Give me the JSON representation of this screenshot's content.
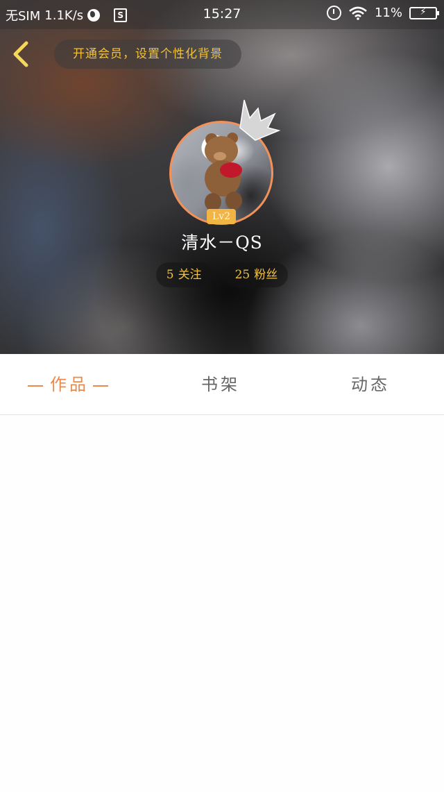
{
  "status_bar": {
    "carrier": "无SIM",
    "net_speed": "1.1K/s",
    "time": "15:27",
    "battery": "11%",
    "icons": [
      "globe-icon",
      "s-app-icon",
      "alarm-icon",
      "wifi-icon",
      "battery-charging-icon"
    ]
  },
  "header": {
    "back_icon": "chevron-left-icon",
    "vip_banner": "开通会员，设置个性化背景",
    "accent_color": "#f2c23a"
  },
  "profile": {
    "level": "Lv2",
    "username": "清水－QS",
    "following_count": "5",
    "following_label": "关注",
    "followers_count": "25",
    "followers_label": "粉丝",
    "avatar_ring_color": "#f2925a"
  },
  "tabs": [
    {
      "label": "作品",
      "active": true
    },
    {
      "label": "书架",
      "active": false
    },
    {
      "label": "动态",
      "active": false
    }
  ],
  "colors": {
    "active_tab": "#e98a4c",
    "inactive_tab": "#666666",
    "badge": "#f2b544"
  }
}
